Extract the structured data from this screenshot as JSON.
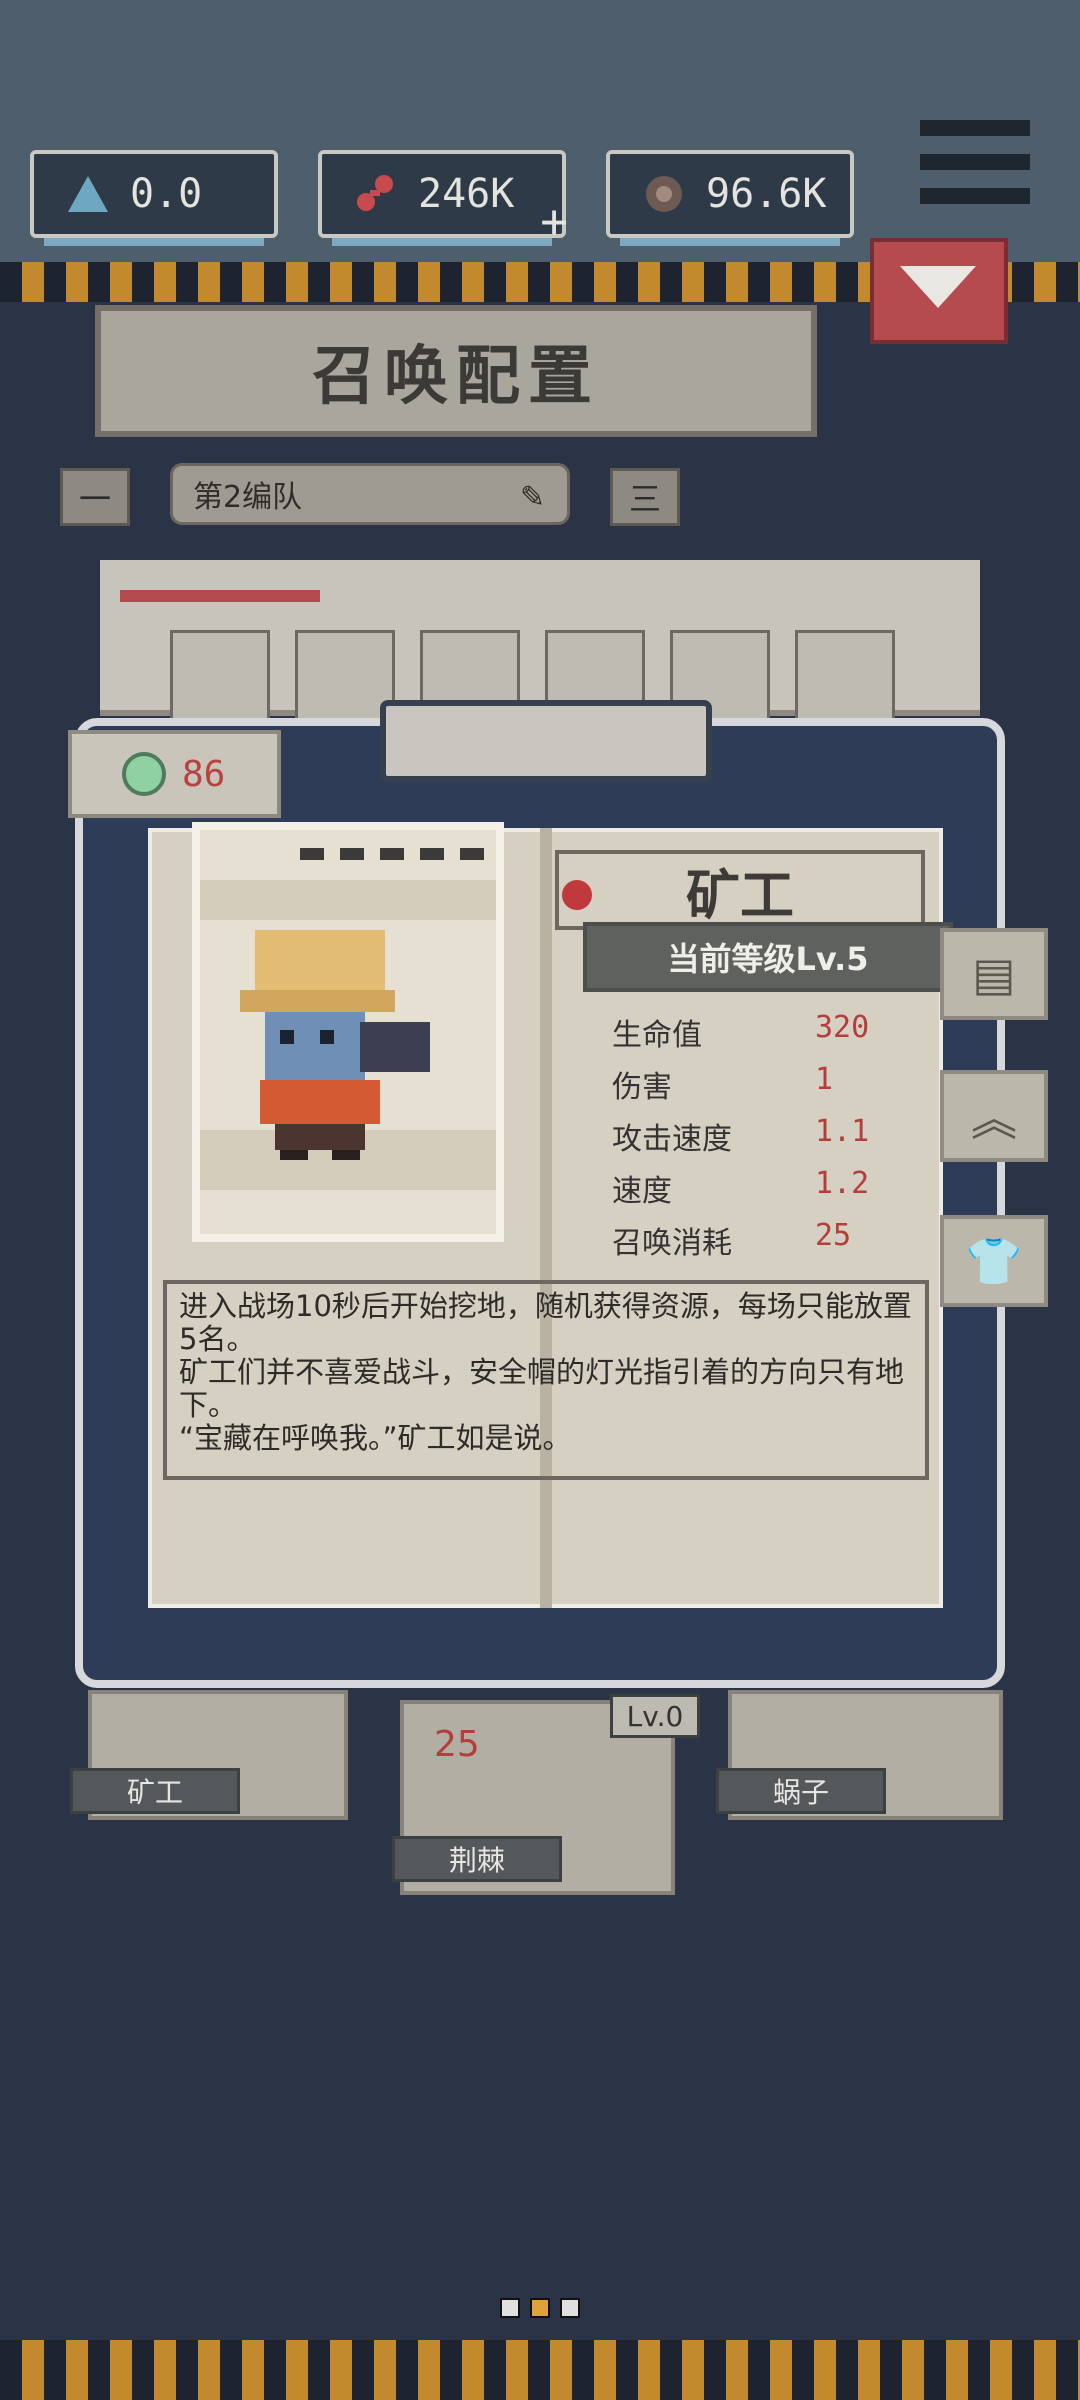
{
  "resources": [
    {
      "icon": "triangle-icon",
      "value": "0.0"
    },
    {
      "icon": "dna-icon",
      "value": "246K",
      "extra": "+"
    },
    {
      "icon": "gear-coin-icon",
      "value": "96.6K"
    }
  ],
  "header": {
    "title": "召唤配置"
  },
  "team": {
    "minus": "一",
    "name": "第2编队",
    "menu": "三"
  },
  "energy": {
    "value": "86"
  },
  "unit": {
    "name": "矿工",
    "level_label": "当前等级Lv.5",
    "stats": [
      {
        "label": "生命值",
        "value": "320"
      },
      {
        "label": "伤害",
        "value": "1"
      },
      {
        "label": "攻击速度",
        "value": "1.1"
      },
      {
        "label": "速度",
        "value": "1.2"
      },
      {
        "label": "召唤消耗",
        "value": "25"
      }
    ],
    "description": "进入战场10秒后开始挖地，随机获得资源，每场只能放置5名。\n矿工们并不喜爱战斗，安全帽的灯光指引着的方向只有地下。\n“宝藏在呼唤我。”矿工如是说。"
  },
  "side_buttons": [
    "book-icon",
    "upgrade-icon",
    "shirt-icon"
  ],
  "cards": [
    {
      "label": "矿工"
    },
    {
      "label": "荆棘",
      "level": "Lv.0",
      "cost": "25"
    },
    {
      "label": "蜗子"
    }
  ],
  "pager": {
    "count": 3,
    "active": 1
  },
  "colors": {
    "accent": "#b54a4f",
    "panel": "#2f3c58",
    "stat_value": "#b23f3c"
  }
}
